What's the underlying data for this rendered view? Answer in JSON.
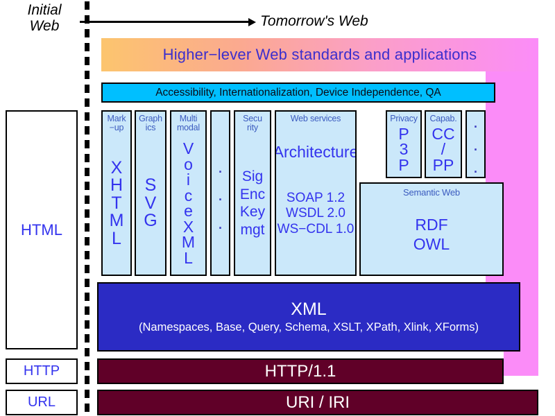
{
  "header": {
    "left_label": "Initial\nWeb",
    "right_label": "Tomorrow's Web",
    "arrow_icon": "right-arrow-icon"
  },
  "banner": {
    "text": "Higher−lever Web standards and applications"
  },
  "horizontal_bar": {
    "text": "Accessibility, Internationalization, Device Independence, QA"
  },
  "legacy_boxes": [
    {
      "label": "HTML"
    },
    {
      "label": "HTTP"
    },
    {
      "label": "URL"
    }
  ],
  "columns": [
    {
      "title": "Mark\n−up",
      "body": "X\nH\nT\nM\nL"
    },
    {
      "title": "Graph\nics",
      "body": "S\nV\nG"
    },
    {
      "title": "Multi\nmodal",
      "body": "V\no\ni\nc\ne\nX\nM\nL"
    },
    {
      "title": "",
      "body": ".\n.\n."
    },
    {
      "title": "Secu\nrity",
      "body": "Sig\nEnc\nKey\nmgt"
    }
  ],
  "web_services": {
    "title": "Web services",
    "headline": "Architecture",
    "items": "SOAP 1.2\nWSDL 2.0\nWS−CDL 1.0"
  },
  "privacy": {
    "title": "Privacy",
    "body": "P\n3\nP"
  },
  "capabilities": {
    "title": "Capab.",
    "body": "CC\n/\nPP"
  },
  "ellipsis_column": {
    "title": "",
    "body": ".\n.\n."
  },
  "semantic_web": {
    "title": "Semantic Web",
    "items": "RDF\nOWL"
  },
  "xml_block": {
    "title": "XML",
    "subtitle": "(Namespaces, Base, Query, Schema, XSLT, XPath, Xlink, XForms)"
  },
  "protocol_bars": [
    {
      "label": "HTTP/1.1"
    },
    {
      "label": "URI / IRI"
    }
  ],
  "colors": {
    "banner_start": "#fcc56e",
    "banner_end": "#fb8cf8",
    "pink": "#fb8cf8",
    "cyan": "#00bfff",
    "light_blue": "#cbe8fa",
    "xml_blue": "#2b2bc4",
    "dark_red": "#600028",
    "text_blue": "#3333ee",
    "title_blue": "#3b5bbf"
  }
}
